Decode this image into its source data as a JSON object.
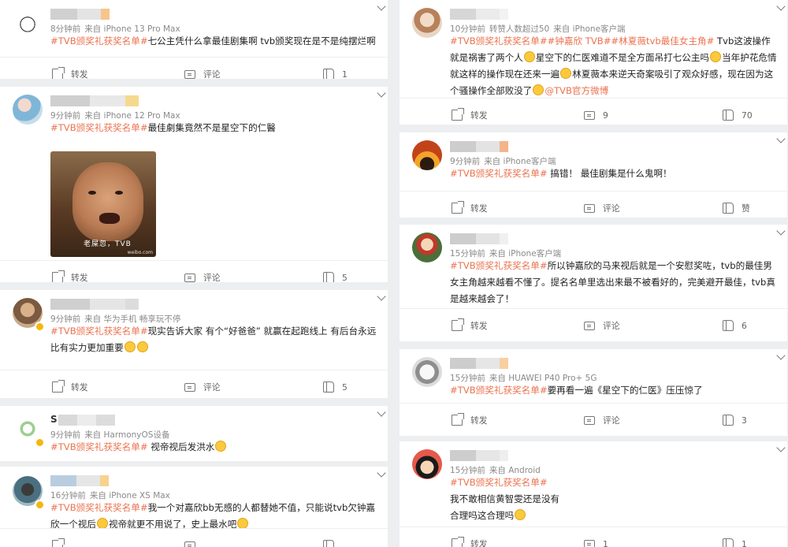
{
  "colors": {
    "accent": "#eb7350",
    "meta": "#8a8a8a",
    "card_bg": "#ffffff",
    "page_bg": "#eceef0"
  },
  "left": [
    {
      "meta": [
        "8分钟前",
        "来自 iPhone 13 Pro Max"
      ],
      "content": [
        [
          "tag",
          "#TVB颁奖礼获奖名单#"
        ],
        [
          "text",
          "七公主凭什么拿最佳剧集啊 tvb颁奖现在是不是纯摆烂啊"
        ]
      ],
      "share": "转发",
      "comment": "评论",
      "like": "1"
    },
    {
      "meta": [
        "9分钟前",
        "来自 iPhone 12 Pro Max"
      ],
      "content": [
        [
          "tag",
          "#TVB颁奖礼获奖名单#"
        ],
        [
          "text",
          "最佳劇集竟然不是星空下的仁醫"
        ]
      ],
      "image_caption": "老屎忽，TVB",
      "image_watermark": "weibo.com",
      "share": "转发",
      "comment": "评论",
      "like": "5"
    },
    {
      "meta": [
        "9分钟前",
        "来自 华为手机 畅享玩不停"
      ],
      "content": [
        [
          "tag",
          "#TVB颁奖礼获奖名单#"
        ],
        [
          "text",
          "现实告诉大家 有个“好爸爸” 就赢在起跑线上 有后台永远比有实力更加重要"
        ],
        [
          "emoji",
          "cry"
        ],
        [
          "emoji",
          "cry"
        ]
      ],
      "share": "转发",
      "comment": "评论",
      "like": "5"
    },
    {
      "name_visible": "S",
      "meta": [
        "9分钟前",
        "来自 HarmonyOS设备"
      ],
      "content": [
        [
          "tag",
          "#TVB颁奖礼获奖名单#"
        ],
        [
          "text",
          " 视帝视后发洪水"
        ],
        [
          "emoji",
          "grin"
        ]
      ],
      "share": "",
      "comment": "",
      "like": ""
    },
    {
      "meta": [
        "16分钟前",
        "来自 iPhone XS Max"
      ],
      "content": [
        [
          "tag",
          "#TVB颁奖礼获奖名单#"
        ],
        [
          "text",
          "我一个对嘉欣bb无感的人都替她不值，只能说tvb欠钟嘉欣一个视后"
        ],
        [
          "emoji",
          "sweat"
        ],
        [
          "text",
          "视帝就更不用说了，史上最水吧"
        ],
        [
          "emoji",
          "cry"
        ]
      ],
      "share": "",
      "comment": "",
      "like": ""
    }
  ],
  "right": [
    {
      "meta": [
        "10分钟前",
        "转赞人数超过50",
        "来自 iPhone客户端"
      ],
      "content": [
        [
          "tag",
          "#TVB颁奖礼获奖名单##钟嘉欣 TVB##林夏薇tvb最佳女主角#"
        ],
        [
          "text",
          " Tvb这波操作就是祸害了两个人"
        ],
        [
          "emoji",
          "smile"
        ],
        [
          "text",
          "星空下的仁医难道不是全方面吊打七公主吗"
        ],
        [
          "emoji",
          "smile"
        ],
        [
          "text",
          "当年护花危情就这样的操作现在还来一遍"
        ],
        [
          "emoji",
          "smile"
        ],
        [
          "text",
          "林夏薇本来逆天奇案吸引了观众好感，现在因为这个骚操作全部败没了"
        ],
        [
          "emoji",
          "smile"
        ],
        [
          "at",
          "@TVB官方微博"
        ]
      ],
      "share": "转发",
      "comment": "9",
      "like": "70"
    },
    {
      "meta": [
        "9分钟前",
        "来自 iPhone客户端"
      ],
      "content": [
        [
          "tag",
          "#TVB颁奖礼获奖名单#"
        ],
        [
          "text",
          " 搞错！ 最佳剧集是什么鬼啊！"
        ]
      ],
      "share": "转发",
      "comment": "评论",
      "like": "赞"
    },
    {
      "meta": [
        "15分钟前",
        "来自 iPhone客户端"
      ],
      "content": [
        [
          "tag",
          "#TVB颁奖礼获奖名单#"
        ],
        [
          "text",
          "所以钟嘉欣的马来视后就是一个安慰奖咗，tvb的最佳男女主角越来越看不懂了。提名名单里选出来最不被看好的，完美避开最佳，tvb真是越来越会了！"
        ]
      ],
      "share": "转发",
      "comment": "评论",
      "like": "6"
    },
    {
      "meta": [
        "15分钟前",
        "来自 HUAWEI P40 Pro+ 5G"
      ],
      "content": [
        [
          "tag",
          "#TVB颁奖礼获奖名单#"
        ],
        [
          "text",
          "要再看一遍《星空下的仁医》压压惊了"
        ]
      ],
      "share": "转发",
      "comment": "评论",
      "like": "3"
    },
    {
      "meta": [
        "15分钟前",
        "来自 Android"
      ],
      "content": [
        [
          "tag",
          "#TVB颁奖礼获奖名单#"
        ],
        [
          "br",
          ""
        ],
        [
          "text",
          "我不敢相信黄智雯还是没有"
        ],
        [
          "br",
          ""
        ],
        [
          "text",
          "合理吗这合理吗"
        ],
        [
          "emoji",
          "doge"
        ]
      ],
      "share": "转发",
      "comment": "1",
      "like": "1"
    }
  ]
}
